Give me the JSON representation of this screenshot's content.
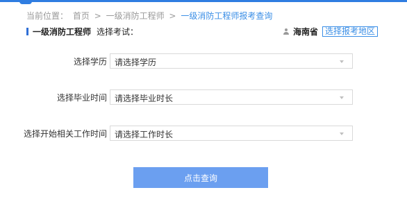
{
  "breadcrumb": {
    "prefix": "当前位置：",
    "home": "首页",
    "separator": ">",
    "category": "一级消防工程师",
    "current": "一级消防工程师报考查询"
  },
  "heading": {
    "title": "一级消防工程师",
    "subtitle": "选择考试："
  },
  "region": {
    "icon": "person-icon",
    "province": "海南省",
    "change_link": "选择报考地区"
  },
  "form": {
    "education": {
      "label": "选择学历",
      "value": "请选择学历"
    },
    "graduation": {
      "label": "选择毕业时间",
      "value": "请选择毕业时长"
    },
    "work_start": {
      "label": "选择开始相关工作时间",
      "value": "请选择工作时长"
    }
  },
  "submit_label": "点击查询",
  "colors": {
    "accent": "#3a8ee6",
    "button": "#6b9ff0",
    "topbar": "#2f7de1"
  }
}
